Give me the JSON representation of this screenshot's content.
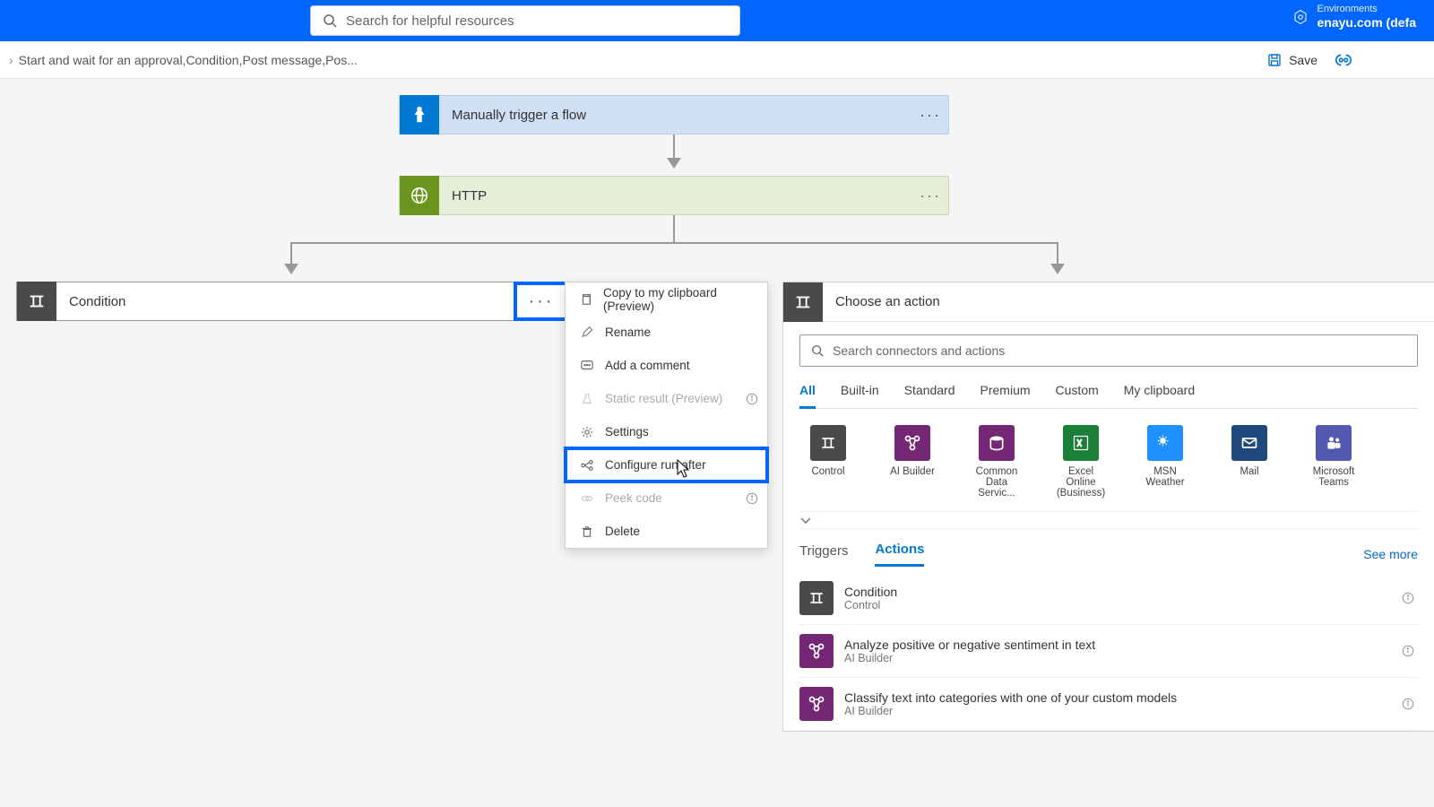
{
  "header": {
    "search_placeholder": "Search for helpful resources",
    "env_label": "Environments",
    "env_value": "enayu.com (defa"
  },
  "subheader": {
    "breadcrumb": "Start and wait for an approval,Condition,Post message,Pos...",
    "save_label": "Save"
  },
  "cards": {
    "trigger_title": "Manually trigger a flow",
    "http_title": "HTTP",
    "condition_title": "Condition"
  },
  "context_menu": {
    "copy": "Copy to my clipboard (Preview)",
    "rename": "Rename",
    "comment": "Add a comment",
    "static": "Static result (Preview)",
    "settings": "Settings",
    "configure": "Configure run after",
    "peek": "Peek code",
    "delete": "Delete"
  },
  "choose": {
    "title": "Choose an action",
    "search_placeholder": "Search connectors and actions",
    "tabs": [
      "All",
      "Built-in",
      "Standard",
      "Premium",
      "Custom",
      "My clipboard"
    ],
    "connectors": [
      {
        "name": "Control",
        "bg": "#4a4a4a"
      },
      {
        "name": "AI Builder",
        "bg": "#742774"
      },
      {
        "name": "Common Data Servic...",
        "bg": "#742774"
      },
      {
        "name": "Excel Online (Business)",
        "bg": "#1a7f37"
      },
      {
        "name": "MSN Weather",
        "bg": "#1e90ff"
      },
      {
        "name": "Mail",
        "bg": "#1f497d"
      },
      {
        "name": "Microsoft Teams",
        "bg": "#5558af"
      }
    ],
    "ta_tabs": [
      "Triggers",
      "Actions"
    ],
    "see_more": "See more",
    "actions": [
      {
        "name": "Condition",
        "sub": "Control",
        "bg": "#4a4a4a"
      },
      {
        "name": "Analyze positive or negative sentiment in text",
        "sub": "AI Builder",
        "bg": "#742774"
      },
      {
        "name": "Classify text into categories with one of your custom models",
        "sub": "AI Builder",
        "bg": "#742774"
      }
    ]
  }
}
